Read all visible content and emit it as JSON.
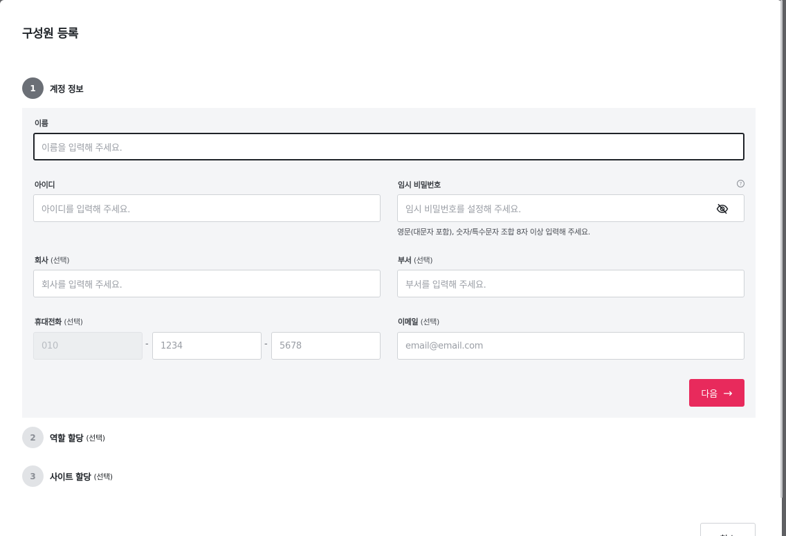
{
  "modal": {
    "title": "구성원 등록"
  },
  "steps": [
    {
      "number": "1",
      "label": "계정 정보",
      "optional": ""
    },
    {
      "number": "2",
      "label": "역할 할당",
      "optional": "(선택)"
    },
    {
      "number": "3",
      "label": "사이트 할당",
      "optional": "(선택)"
    }
  ],
  "form": {
    "name": {
      "label": "이름",
      "placeholder": "이름을 입력해 주세요."
    },
    "id": {
      "label": "아이디",
      "placeholder": "아이디를 입력해 주세요."
    },
    "password": {
      "label": "임시 비밀번호",
      "placeholder": "임시 비밀번호를 설정해 주세요.",
      "hint": "영문(대문자 포함), 숫자/특수문자 조합 8자 이상 입력해 주세요.",
      "help_icon": "question-circle-icon",
      "toggle_icon": "eye-off-icon"
    },
    "company": {
      "label": "회사",
      "optional": "(선택)",
      "placeholder": "회사를 입력해 주세요."
    },
    "department": {
      "label": "부서",
      "optional": "(선택)",
      "placeholder": "부서를 입력해 주세요."
    },
    "phone": {
      "label": "휴대전화",
      "optional": "(선택)",
      "prefix": "010",
      "middle": "1234",
      "last": "5678",
      "separator": "-"
    },
    "email": {
      "label": "이메일",
      "optional": "(선택)",
      "placeholder": "email@email.com"
    }
  },
  "buttons": {
    "next": "다음",
    "next_icon": "arrow-right-icon",
    "cancel": "취소"
  },
  "colors": {
    "accent": "#e8194f",
    "step_active": "#6b6f76",
    "panel_bg": "#f4f5f7"
  }
}
